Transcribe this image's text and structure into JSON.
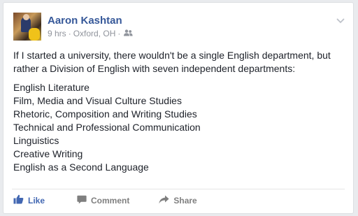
{
  "post": {
    "author": "Aaron Kashtan",
    "time": "9 hrs",
    "location": "Oxford, OH",
    "separator": "·",
    "audience_icon": "friends-icon",
    "intro": "If I started a university, there wouldn't be a single English department, but rather a Division of English with seven independent departments:",
    "departments": [
      "English Literature",
      "Film, Media and Visual Culture Studies",
      "Rhetoric, Composition and Writing Studies",
      "Technical and Professional Communication",
      "Linguistics",
      "Creative Writing",
      "English as a Second Language"
    ]
  },
  "actions": {
    "like": "Like",
    "comment": "Comment",
    "share": "Share"
  },
  "colors": {
    "link_blue": "#365899",
    "like_blue": "#4267b2",
    "meta_gray": "#90949c",
    "action_gray": "#7f7f7f"
  }
}
